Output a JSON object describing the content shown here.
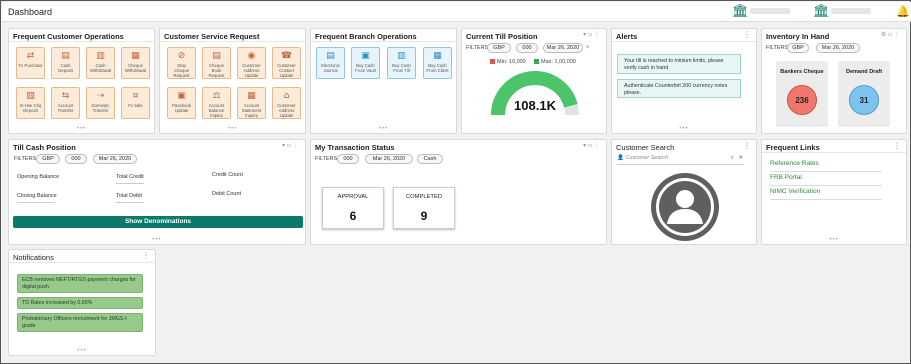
{
  "header": {
    "title": "Dashboard"
  },
  "frequent_customer_ops": {
    "title": "Frequent Customer Operations",
    "tiles": [
      "Fx Purchase",
      "Cash Deposit",
      "Cash Withdrawal",
      "Cheque Withdrawal",
      "In-Hse Chq Deposit",
      "Account Transfer",
      "Domestic Transfer",
      "Fx Sale"
    ]
  },
  "customer_service": {
    "title": "Customer Service Request",
    "tiles": [
      "Stop Cheque Request",
      "Cheque Book Request",
      "Customer Address Update",
      "Customer Contact Update",
      "Passbook Update",
      "Account Balance Inquiry",
      "Account Statement Inquiry",
      "Customer Address Update"
    ]
  },
  "branch_ops": {
    "title": "Frequent Branch Operations",
    "tiles": [
      "Electronic Journal",
      "Buy Cash From Vault",
      "Buy Cash From Till",
      "Buy Cash From Client"
    ]
  },
  "till_position": {
    "title": "Current Till Position",
    "filters_label": "FILTERS",
    "currency": "GBP",
    "branch": "000",
    "date": "Mar 26, 2020",
    "min_label": "Min: 10,000",
    "max_label": "Max: 1,00,000",
    "value": "108.1K",
    "gauge_fraction": 0.92,
    "colors": {
      "gauge": "#4cc46a",
      "min": "#e2554a",
      "max": "#3aa65a"
    }
  },
  "alerts": {
    "title": "Alerts",
    "items": [
      "Your till is reached to minium limits, please verify cash in hand",
      "Authenticate Counterfeit 200 currency notes please."
    ]
  },
  "inventory": {
    "title": "Inventory In Hand",
    "filters_label": "FILTERS",
    "currency": "GBP",
    "date": "Mar 26, 2020",
    "items": [
      {
        "label": "Bankers Cheque",
        "value": "236",
        "color": "#f0776c"
      },
      {
        "label": "Demand Draft",
        "value": "31",
        "color": "#7fc4f0"
      }
    ]
  },
  "till_cash": {
    "title": "Till Cash Position",
    "filters_label": "FILTERS",
    "currency": "GBP",
    "branch": "000",
    "date": "Mar 26, 2020",
    "opening_balance": "Opening Balance",
    "closing_balance": "Closing Balance",
    "total_credit": "Total Credit",
    "total_debit": "Total Debit",
    "credit_count": "Credit Count",
    "debit_count": "Debit Count",
    "button": "Show Denominations"
  },
  "transactions": {
    "title": "My Transaction Status",
    "filters_label": "FILTERS",
    "branch": "000",
    "date": "Mar 26, 2020",
    "mode": "Cash",
    "approval_label": "APPROVAL",
    "approval_value": "6",
    "completed_label": "COMPLETED",
    "completed_value": "9"
  },
  "customer_search": {
    "title": "Customer Search",
    "placeholder": "Customer Search"
  },
  "links": {
    "title": "Frequent Links",
    "items": [
      "Reference Rates",
      "FRB Portal",
      "NIMC Verification"
    ]
  },
  "notifications": {
    "title": "Notifications",
    "items": [
      "ECB removes NEFT/RTGS payment charges for digital push",
      "TD Rates increased by 0.65%",
      "Probationary Officers recruitment for JMGS-I grade"
    ]
  }
}
